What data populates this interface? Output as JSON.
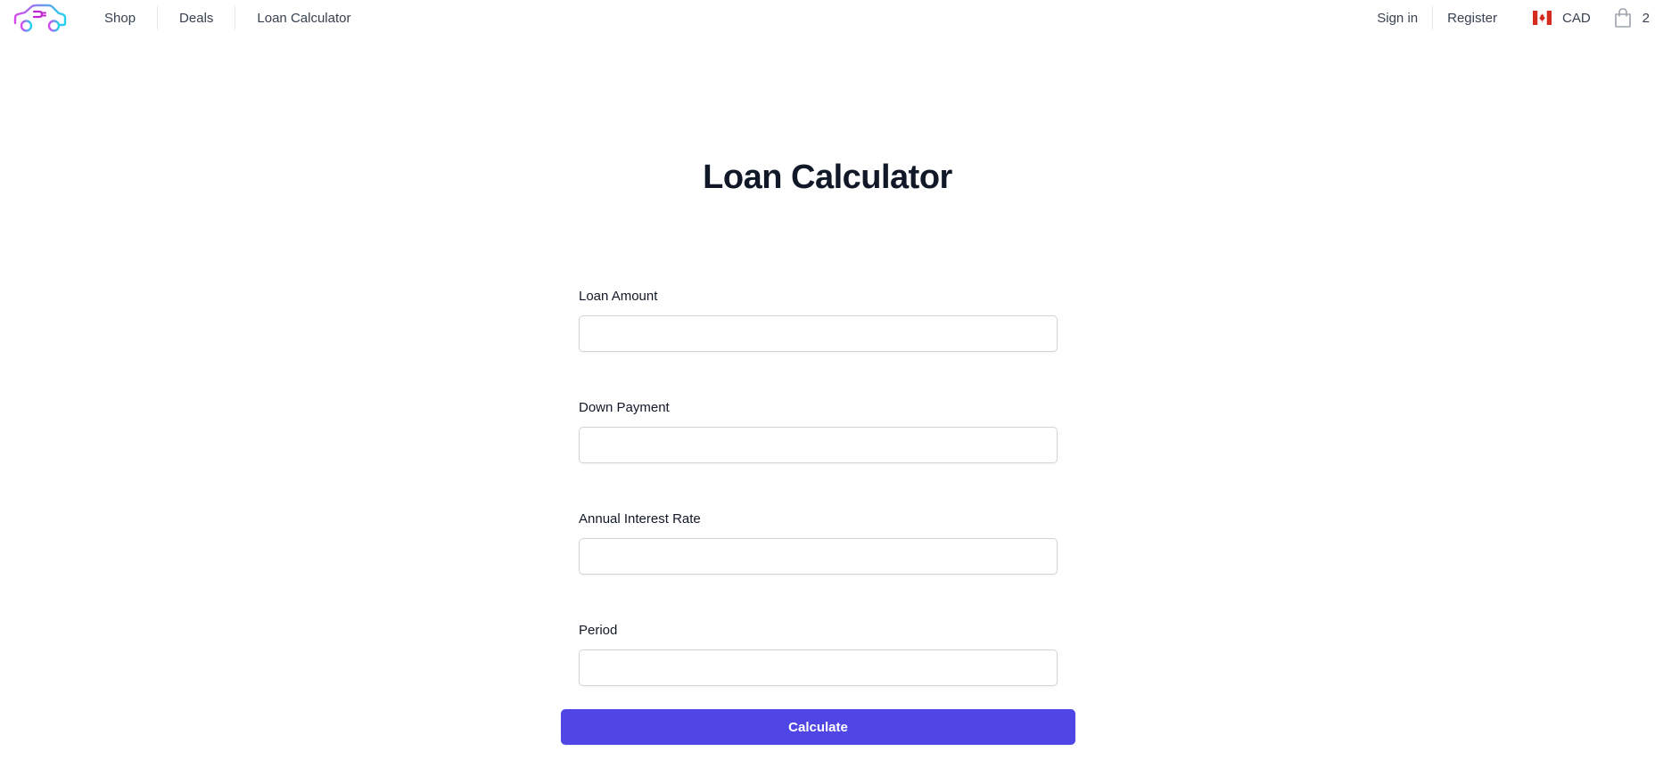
{
  "header": {
    "logo_icon": "electric-car-plug-icon",
    "nav": [
      {
        "label": "Shop"
      },
      {
        "label": "Deals"
      },
      {
        "label": "Loan Calculator"
      }
    ],
    "sign_in": "Sign in",
    "register": "Register",
    "currency": {
      "flag_icon": "canada-flag-icon",
      "label": "CAD"
    },
    "cart": {
      "icon": "shopping-bag-icon",
      "count": "2"
    }
  },
  "main": {
    "title": "Loan Calculator",
    "fields": [
      {
        "label": "Loan Amount",
        "value": "",
        "placeholder": ""
      },
      {
        "label": "Down Payment",
        "value": "",
        "placeholder": ""
      },
      {
        "label": "Annual Interest Rate",
        "value": "",
        "placeholder": ""
      },
      {
        "label": "Period",
        "value": "",
        "placeholder": ""
      }
    ],
    "calculate_label": "Calculate"
  },
  "colors": {
    "accent": "#4f46e5",
    "logo_gradient_start": "#d946ef",
    "logo_gradient_end": "#22d3ee",
    "text": "#111827"
  }
}
